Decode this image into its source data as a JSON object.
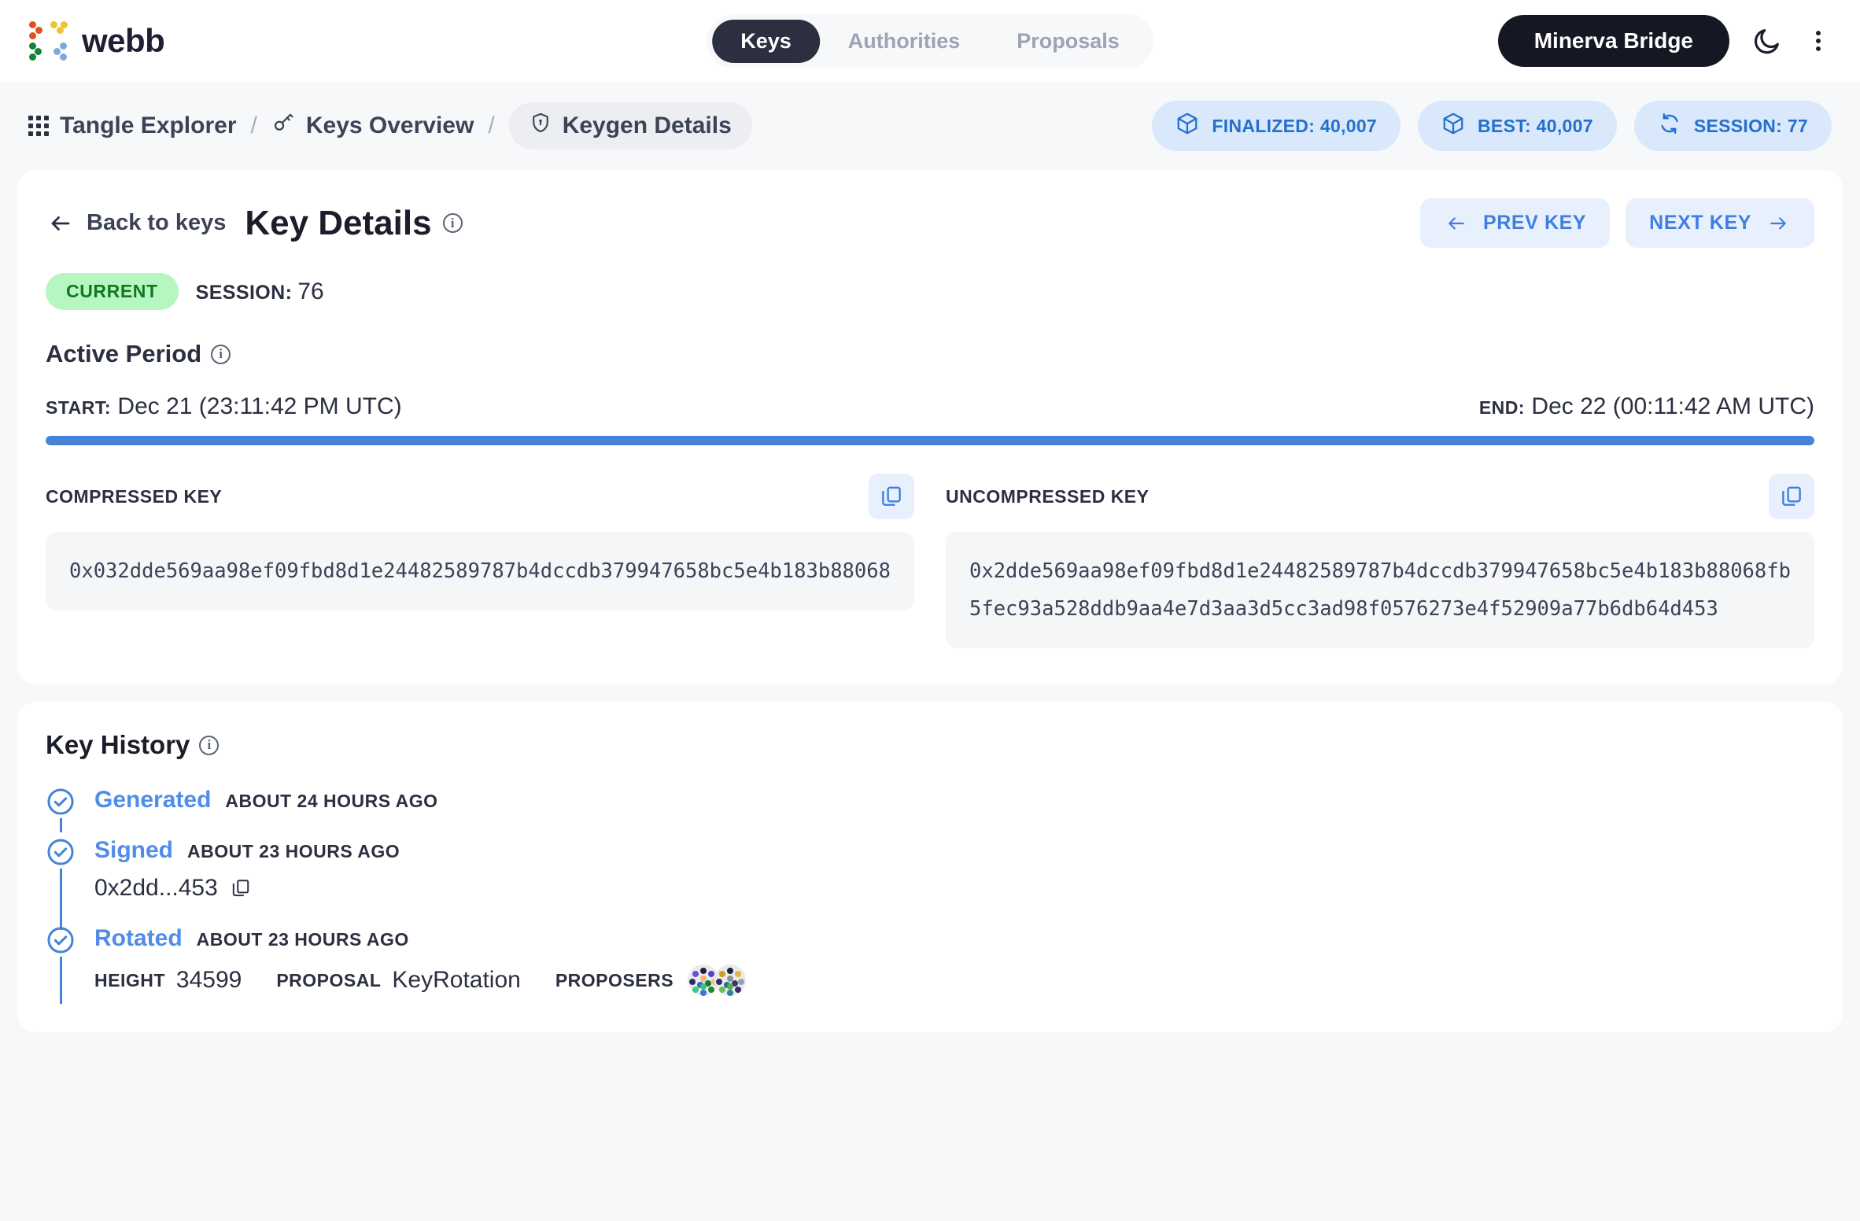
{
  "header": {
    "brand": "webb",
    "tabs": [
      {
        "label": "Keys",
        "active": true
      },
      {
        "label": "Authorities",
        "active": false
      },
      {
        "label": "Proposals",
        "active": false
      }
    ],
    "bridge_button": "Minerva Bridge",
    "theme_icon": "moon-icon",
    "menu_icon": "vertical-dots-icon",
    "accent": "#4583d8"
  },
  "breadcrumb": {
    "items": [
      {
        "label": "Tangle Explorer",
        "icon": "grid-apps-icon"
      },
      {
        "label": "Keys Overview",
        "icon": "key-icon"
      },
      {
        "label": "Keygen Details",
        "icon": "shield-lock-icon"
      }
    ],
    "separator": "/",
    "chips": [
      {
        "label": "FINALIZED: 40,007",
        "icon": "cube-icon"
      },
      {
        "label": "BEST: 40,007",
        "icon": "cube-icon"
      },
      {
        "label": "SESSION: 77",
        "icon": "refresh-icon"
      }
    ]
  },
  "key_details": {
    "back_label": "Back to keys",
    "title": "Key Details",
    "prev_label": "PREV KEY",
    "next_label": "NEXT KEY",
    "status_badge": "CURRENT",
    "session_label": "SESSION:",
    "session_value": "76",
    "active_period_title": "Active Period",
    "start_label": "START:",
    "start_value": "Dec 21 (23:11:42 PM UTC)",
    "end_label": "END:",
    "end_value": "Dec 22 (00:11:42 AM UTC)",
    "progress_percent": 100,
    "compressed_label": "COMPRESSED KEY",
    "compressed_value": "0x032dde569aa98ef09fbd8d1e24482589787b4dccdb379947658bc5e4b183b88068",
    "uncompressed_label": "UNCOMPRESSED KEY",
    "uncompressed_value": "0x2dde569aa98ef09fbd8d1e24482589787b4dccdb379947658bc5e4b183b88068fb5fec93a528ddb9aa4e7d3aa3d5cc3ad98f0576273e4f52909a77b6db64d453",
    "copy_icon": "copy-icon"
  },
  "key_history": {
    "title": "Key History",
    "events": [
      {
        "status": "Generated",
        "time": "ABOUT 24 HOURS AGO",
        "hash": null
      },
      {
        "status": "Signed",
        "time": "ABOUT 23 HOURS AGO",
        "hash": "0x2dd...453"
      },
      {
        "status": "Rotated",
        "time": "ABOUT 23 HOURS AGO",
        "height_label": "HEIGHT",
        "height_value": "34599",
        "proposal_label": "PROPOSAL",
        "proposal_value": "KeyRotation",
        "proposers_label": "PROPOSERS"
      }
    ]
  }
}
